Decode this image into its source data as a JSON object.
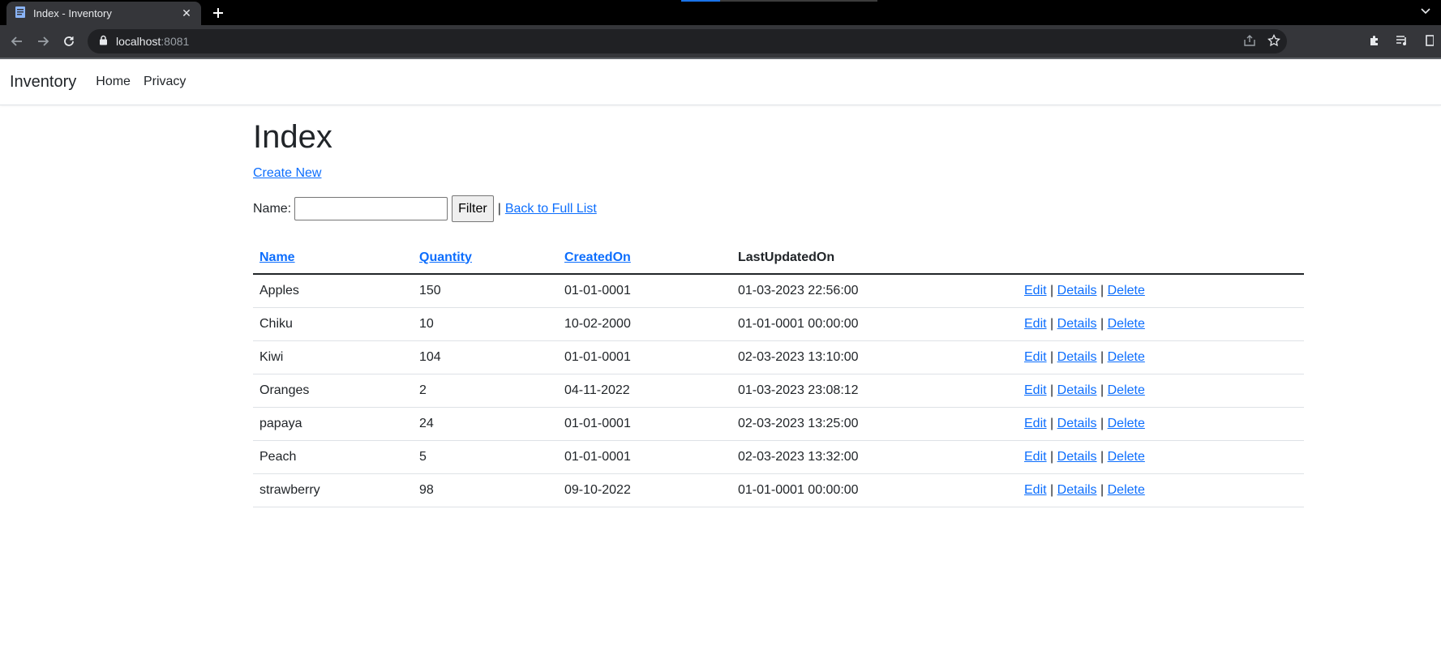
{
  "browser": {
    "tab_title": "Index - Inventory",
    "url_host": "localhost",
    "url_port": ":8081"
  },
  "navbar": {
    "brand": "Inventory",
    "links": [
      "Home",
      "Privacy"
    ]
  },
  "page": {
    "title": "Index",
    "create_new": "Create New",
    "filter_label": "Name:",
    "filter_value": "",
    "filter_button": "Filter",
    "separator": "|",
    "back_link": "Back to Full List"
  },
  "table": {
    "headers": [
      "Name",
      "Quantity",
      "CreatedOn",
      "LastUpdatedOn",
      ""
    ],
    "rows": [
      {
        "name": "Apples",
        "quantity": "150",
        "created": "01-01-0001",
        "updated": "01-03-2023 22:56:00"
      },
      {
        "name": "Chiku",
        "quantity": "10",
        "created": "10-02-2000",
        "updated": "01-01-0001 00:00:00"
      },
      {
        "name": "Kiwi",
        "quantity": "104",
        "created": "01-01-0001",
        "updated": "02-03-2023 13:10:00"
      },
      {
        "name": "Oranges",
        "quantity": "2",
        "created": "04-11-2022",
        "updated": "01-03-2023 23:08:12"
      },
      {
        "name": "papaya",
        "quantity": "24",
        "created": "01-01-0001",
        "updated": "02-03-2023 13:25:00"
      },
      {
        "name": "Peach",
        "quantity": "5",
        "created": "01-01-0001",
        "updated": "02-03-2023 13:32:00"
      },
      {
        "name": "strawberry",
        "quantity": "98",
        "created": "09-10-2022",
        "updated": "01-01-0001 00:00:00"
      }
    ],
    "actions": {
      "edit": "Edit",
      "details": "Details",
      "delete": "Delete",
      "sep": "|"
    }
  },
  "colors": {
    "link": "#0d6efd",
    "chrome_dark": "#35363a",
    "tabstrip": "#000000"
  }
}
